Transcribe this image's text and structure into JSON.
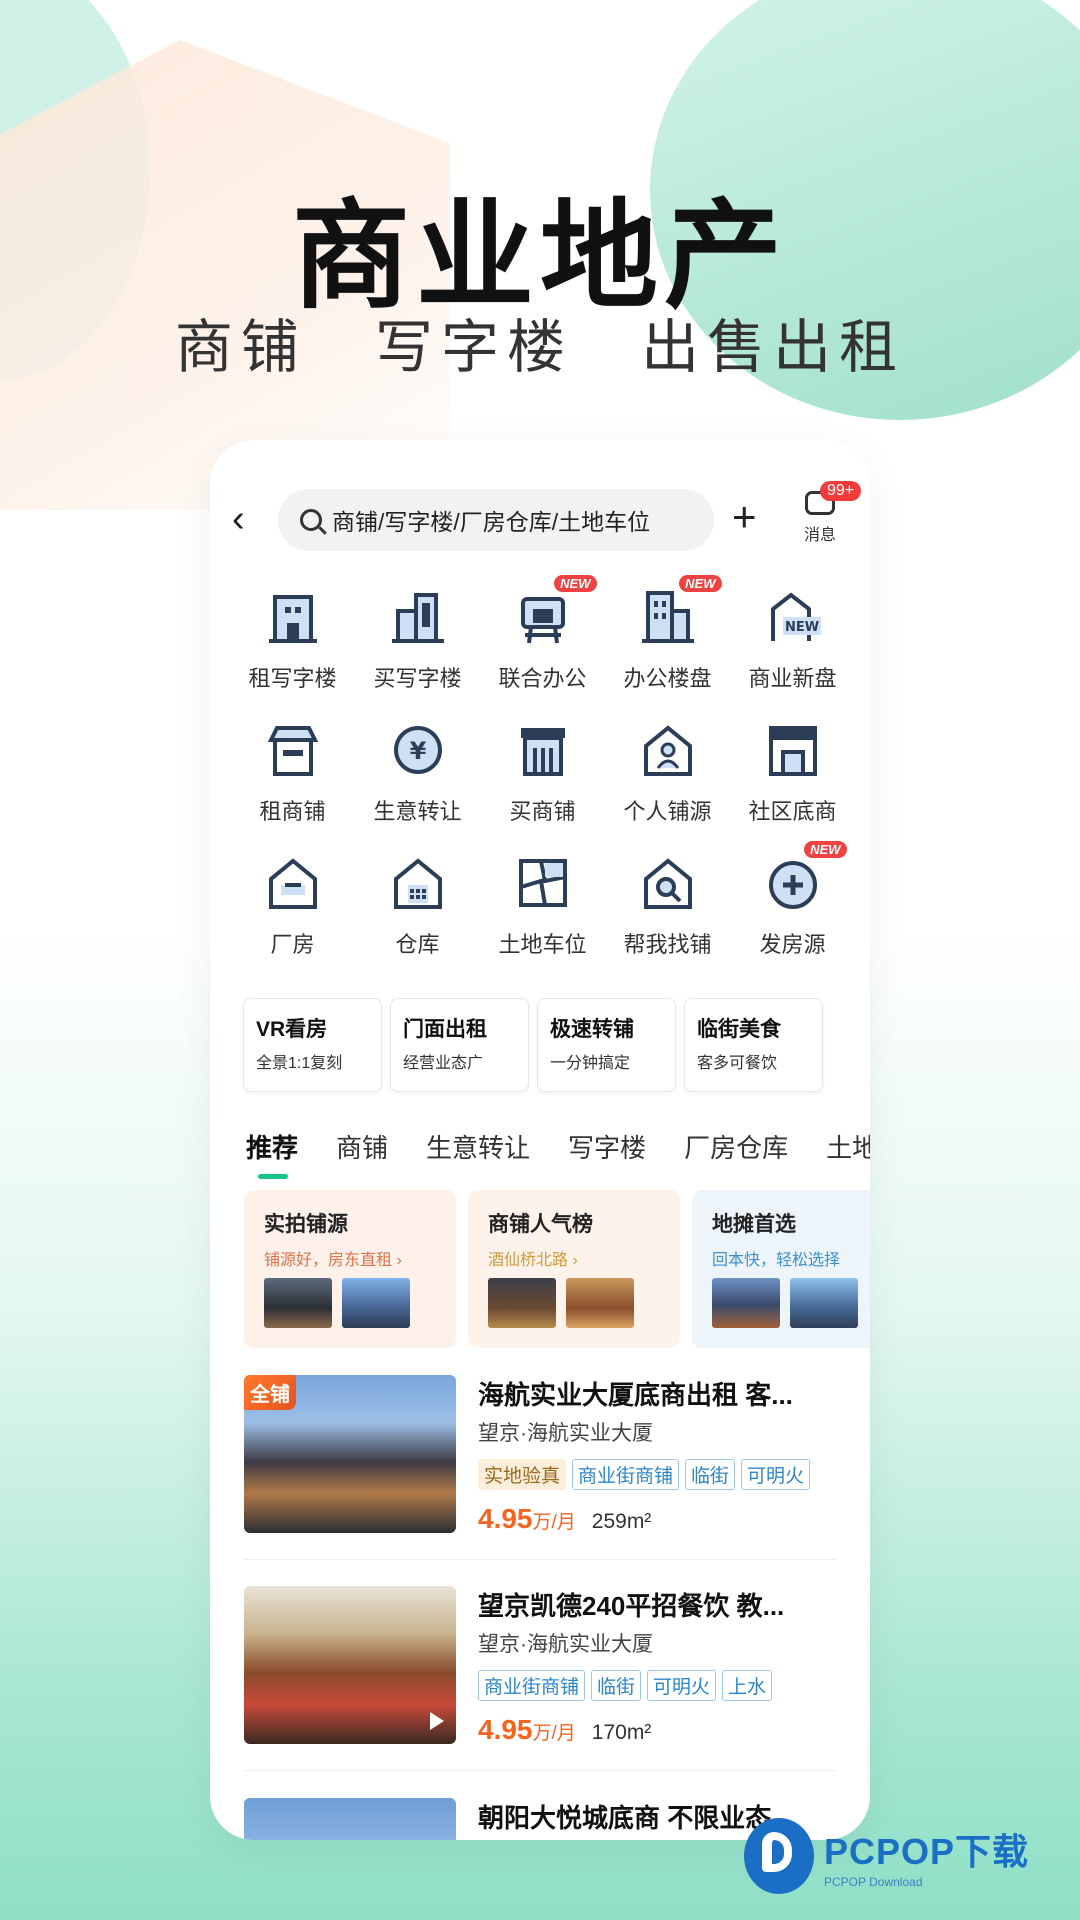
{
  "hero": {
    "title": "商业地产",
    "subtitle": [
      "商铺",
      "写字楼",
      "出售出租"
    ]
  },
  "topbar": {
    "search_placeholder": "商铺/写字楼/厂房仓库/土地车位",
    "message_label": "消息",
    "message_badge": "99+"
  },
  "categories": [
    {
      "label": "租写字楼",
      "icon": "office-building-icon",
      "new": false
    },
    {
      "label": "买写字楼",
      "icon": "tower-building-icon",
      "new": false
    },
    {
      "label": "联合办公",
      "icon": "shared-office-icon",
      "new": true
    },
    {
      "label": "办公楼盘",
      "icon": "office-complex-icon",
      "new": true
    },
    {
      "label": "商业新盘",
      "icon": "new-house-icon",
      "new": false
    },
    {
      "label": "租商铺",
      "icon": "shop-icon",
      "new": false
    },
    {
      "label": "生意转让",
      "icon": "yuan-transfer-icon",
      "new": false
    },
    {
      "label": "买商铺",
      "icon": "storefront-icon",
      "new": false
    },
    {
      "label": "个人铺源",
      "icon": "person-house-icon",
      "new": false
    },
    {
      "label": "社区底商",
      "icon": "community-shop-icon",
      "new": false
    },
    {
      "label": "厂房",
      "icon": "factory-house-icon",
      "new": false
    },
    {
      "label": "仓库",
      "icon": "warehouse-icon",
      "new": false
    },
    {
      "label": "土地车位",
      "icon": "land-map-icon",
      "new": false
    },
    {
      "label": "帮我找铺",
      "icon": "search-house-icon",
      "new": false
    },
    {
      "label": "发房源",
      "icon": "plus-circle-icon",
      "new": true
    }
  ],
  "new_badge": "NEW",
  "new_house_text": "NEW",
  "quick_cards": [
    {
      "title": "VR看房",
      "sub": "全景1:1复刻"
    },
    {
      "title": "门面出租",
      "sub": "经营业态广"
    },
    {
      "title": "极速转铺",
      "sub": "一分钟搞定"
    },
    {
      "title": "临街美食",
      "sub": "客多可餐饮"
    }
  ],
  "tabs": [
    "推荐",
    "商铺",
    "生意转让",
    "写字楼",
    "厂房仓库",
    "土地"
  ],
  "promos": [
    {
      "title": "实拍铺源",
      "sub": "铺源好，房东直租 ›",
      "sub_color": "#e0734a",
      "bg": "#fdf1ea"
    },
    {
      "title": "商铺人气榜",
      "sub": "酒仙桥北路 ›",
      "sub_color": "#d39a3c",
      "bg": "#fdf3ea"
    },
    {
      "title": "地摊首选",
      "sub": "回本快，轻松选择",
      "sub_color": "#3d8fd0",
      "bg": "#eef5fa"
    }
  ],
  "listings": [
    {
      "image_tag": "全铺",
      "title": "海航实业大厦底商出租 客...",
      "location": "望京·海航实业大厦",
      "tags": [
        "实地验真",
        "商业街商铺",
        "临街",
        "可明火"
      ],
      "price": "4.95",
      "unit": "万/月",
      "area": "259m²"
    },
    {
      "image_tag": "",
      "title": "望京凯德240平招餐饮 教...",
      "location": "望京·海航实业大厦",
      "tags": [
        "商业街商铺",
        "临街",
        "可明火",
        "上水"
      ],
      "price": "4.95",
      "unit": "万/月",
      "area": "170m²"
    },
    {
      "image_tag": "",
      "title": "朝阳大悦城底商 不限业态",
      "location": "",
      "tags": [],
      "price": "",
      "unit": "",
      "area": ""
    }
  ],
  "watermark": {
    "title": "PCPOP下载",
    "sub": "PCPOP Download"
  },
  "colors": {
    "accent": "#18c28e",
    "price": "#f26420",
    "badge": "#ef4242",
    "tag_blue": "#2b86c9"
  }
}
